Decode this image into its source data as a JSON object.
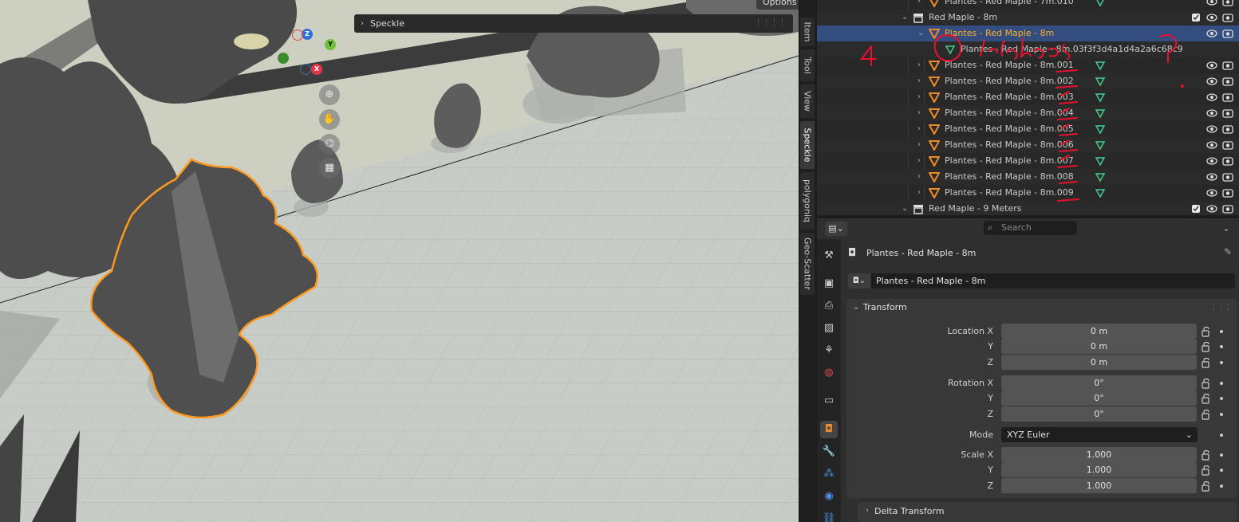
{
  "viewport": {
    "options_label": "Options",
    "speckle_panel_label": "Speckle",
    "gizmo": {
      "z": "Z",
      "y": "Y",
      "x": "X"
    },
    "nav_icons": [
      "zoom-icon",
      "hand-pan-icon",
      "camera-icon",
      "grid-perspective-icon"
    ],
    "selection_color": "#ff9a1f"
  },
  "n_tabs": [
    "Item",
    "Tool",
    "View",
    "Speckle",
    "polygoniq",
    "Geo-Scatter"
  ],
  "outliner": {
    "rows": [
      {
        "label": "Plantes - Red Maple - 7m.010",
        "type": "object",
        "indent": 2
      },
      {
        "label": "Red Maple - 8m",
        "type": "collection",
        "indent": 1
      },
      {
        "label": "Plantes - Red Maple - 8m",
        "type": "object",
        "indent": 2,
        "selected": true
      },
      {
        "label": "Plantes - Red Maple - 8m.03f3f3d4a1d4a2a6c68c9",
        "type": "mesh",
        "indent": 3
      },
      {
        "label": "Plantes - Red Maple - 8m.001",
        "type": "object",
        "indent": 2
      },
      {
        "label": "Plantes - Red Maple - 8m.002",
        "type": "object",
        "indent": 2
      },
      {
        "label": "Plantes - Red Maple - 8m.003",
        "type": "object",
        "indent": 2
      },
      {
        "label": "Plantes - Red Maple - 8m.004",
        "type": "object",
        "indent": 2
      },
      {
        "label": "Plantes - Red Maple - 8m.005",
        "type": "object",
        "indent": 2
      },
      {
        "label": "Plantes - Red Maple - 8m.006",
        "type": "object",
        "indent": 2
      },
      {
        "label": "Plantes - Red Maple - 8m.007",
        "type": "object",
        "indent": 2
      },
      {
        "label": "Plantes - Red Maple - 8m.008",
        "type": "object",
        "indent": 2
      },
      {
        "label": "Plantes - Red Maple - 8m.009",
        "type": "object",
        "indent": 2
      },
      {
        "label": "Red Maple - 9 Meters",
        "type": "collection",
        "indent": 1
      }
    ],
    "annotation_color": "#e8102a"
  },
  "properties": {
    "search_placeholder": "Search",
    "object_name": "Plantes - Red Maple - 8m",
    "object_field": "Plantes - Red Maple - 8m",
    "transform_header": "Transform",
    "location": {
      "label_x": "Location X",
      "label_y": "Y",
      "label_z": "Z",
      "x": "0 m",
      "y": "0 m",
      "z": "0 m"
    },
    "rotation": {
      "label_x": "Rotation X",
      "label_y": "Y",
      "label_z": "Z",
      "x": "0°",
      "y": "0°",
      "z": "0°"
    },
    "mode_label": "Mode",
    "mode_value": "XYZ Euler",
    "scale": {
      "label_x": "Scale X",
      "label_y": "Y",
      "label_z": "Z",
      "x": "1.000",
      "y": "1.000",
      "z": "1.000"
    },
    "delta_transform_header": "Delta Transform"
  }
}
